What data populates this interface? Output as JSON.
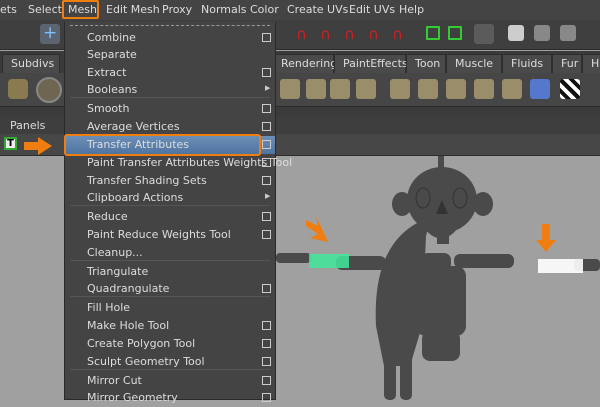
{
  "menubar": {
    "items": [
      "ets",
      "Select",
      "Mesh",
      "Edit Mesh",
      "Proxy",
      "Normals",
      "Color",
      "Create UVs",
      "Edit UVs",
      "Help"
    ],
    "active": "Mesh"
  },
  "shelf_tabs": [
    "Subdivs",
    "Rendering",
    "PaintEffects",
    "Toon",
    "Muscle",
    "Fluids",
    "Fur",
    "H"
  ],
  "panels_label": "Panels",
  "panel_toolbar_icon": "T",
  "mesh_menu": {
    "items": [
      {
        "label": "Combine",
        "option": true
      },
      {
        "label": "Separate",
        "option": false
      },
      {
        "label": "Extract",
        "option": true
      },
      {
        "label": "Booleans",
        "submenu": true
      },
      {
        "label": "Smooth",
        "option": true
      },
      {
        "label": "Average Vertices",
        "option": true
      },
      {
        "label": "Transfer Attributes",
        "option": true,
        "highlighted": true
      },
      {
        "label": "Paint Transfer Attributes Weights Tool",
        "option": true
      },
      {
        "label": "Transfer Shading Sets",
        "option": true
      },
      {
        "label": "Clipboard Actions",
        "submenu": true
      },
      {
        "label": "Reduce",
        "option": true
      },
      {
        "label": "Paint Reduce Weights Tool",
        "option": true
      },
      {
        "label": "Cleanup...",
        "option": false
      },
      {
        "label": "Triangulate",
        "option": false
      },
      {
        "label": "Quadrangulate",
        "option": true
      },
      {
        "label": "Fill Hole",
        "option": false
      },
      {
        "label": "Make Hole Tool",
        "option": true
      },
      {
        "label": "Create Polygon Tool",
        "option": true
      },
      {
        "label": "Sculpt Geometry Tool",
        "option": true
      },
      {
        "label": "Mirror Cut",
        "option": true
      },
      {
        "label": "Mirror Geometry",
        "option": true
      }
    ]
  },
  "colors": {
    "highlight_outline": "#f07d10",
    "menu_bg": "#444444",
    "viewport_bg": "#a0a0a0",
    "selected_source": "#3fe89a",
    "selected_target": "#ffffff"
  }
}
